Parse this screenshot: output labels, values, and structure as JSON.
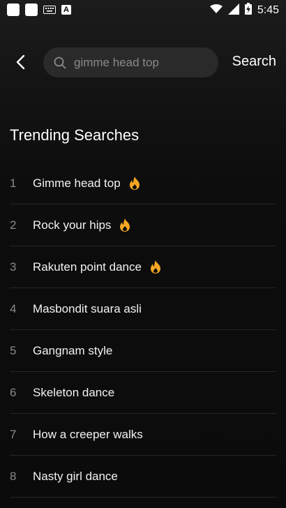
{
  "status_bar": {
    "time": "5:45",
    "left_icons": [
      "app-icon",
      "app-icon",
      "keyboard-icon",
      "a-app-icon"
    ],
    "right_icons": [
      "wifi-icon",
      "signal-icon",
      "battery-charging-icon"
    ],
    "a_glyph": "A"
  },
  "header": {
    "back_icon": "chevron-left-icon",
    "search_placeholder": "gimme head top",
    "search_button_label": "Search"
  },
  "trending": {
    "title": "Trending Searches",
    "hot_icon": "flame-icon",
    "hot_color": "#f5a623",
    "items": [
      {
        "rank": "1",
        "label": "Gimme head top",
        "hot": true
      },
      {
        "rank": "2",
        "label": "Rock your hips",
        "hot": true
      },
      {
        "rank": "3",
        "label": "Rakuten point dance",
        "hot": true
      },
      {
        "rank": "4",
        "label": "Masbondit suara asli",
        "hot": false
      },
      {
        "rank": "5",
        "label": "Gangnam style",
        "hot": false
      },
      {
        "rank": "6",
        "label": "Skeleton dance",
        "hot": false
      },
      {
        "rank": "7",
        "label": "How a creeper walks",
        "hot": false
      },
      {
        "rank": "8",
        "label": "Nasty girl dance",
        "hot": false
      }
    ]
  }
}
